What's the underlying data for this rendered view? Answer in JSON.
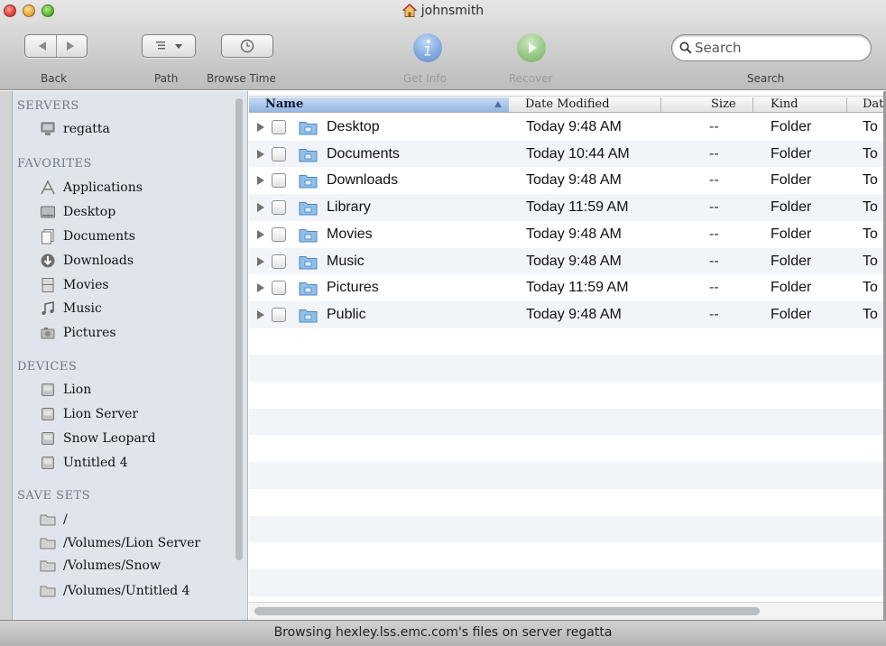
{
  "window": {
    "title": "johnsmith",
    "title_icon": "home-icon"
  },
  "toolbar": {
    "back_label": "Back",
    "path_label": "Path",
    "browse_time_label": "Browse Time",
    "get_info_label": "Get Info",
    "recover_label": "Recover",
    "search_label": "Search",
    "search_placeholder": "Search"
  },
  "sidebar": {
    "sections": [
      {
        "header": "SERVERS",
        "items": [
          {
            "label": "regatta",
            "icon": "server-icon"
          }
        ]
      },
      {
        "header": "FAVORITES",
        "items": [
          {
            "label": "Applications",
            "icon": "applications-icon"
          },
          {
            "label": "Desktop",
            "icon": "desktop-icon"
          },
          {
            "label": "Documents",
            "icon": "documents-icon"
          },
          {
            "label": "Downloads",
            "icon": "downloads-icon"
          },
          {
            "label": "Movies",
            "icon": "movies-icon"
          },
          {
            "label": "Music",
            "icon": "music-icon"
          },
          {
            "label": "Pictures",
            "icon": "pictures-icon"
          }
        ]
      },
      {
        "header": "DEVICES",
        "items": [
          {
            "label": "Lion",
            "icon": "disk-icon"
          },
          {
            "label": "Lion Server",
            "icon": "disk-icon"
          },
          {
            "label": "Snow Leopard",
            "icon": "disk-icon"
          },
          {
            "label": "Untitled 4",
            "icon": "disk-icon"
          }
        ]
      },
      {
        "header": "SAVE SETS",
        "items": [
          {
            "label": "/",
            "icon": "folder-icon"
          },
          {
            "label": "/Volumes/Lion Server",
            "icon": "folder-icon"
          },
          {
            "label": "/Volumes/Snow",
            "icon": "folder-icon"
          },
          {
            "label": "/Volumes/Untitled 4",
            "icon": "folder-icon"
          }
        ]
      }
    ]
  },
  "filelist": {
    "columns": [
      "Name",
      "Date Modified",
      "Size",
      "Kind",
      "Dat"
    ],
    "rows": [
      {
        "name": "Desktop",
        "date": "Today 9:48 AM",
        "size": "--",
        "kind": "Folder",
        "extra": "To"
      },
      {
        "name": "Documents",
        "date": "Today 10:44 AM",
        "size": "--",
        "kind": "Folder",
        "extra": "To"
      },
      {
        "name": "Downloads",
        "date": "Today 9:48 AM",
        "size": "--",
        "kind": "Folder",
        "extra": "To"
      },
      {
        "name": "Library",
        "date": "Today 11:59 AM",
        "size": "--",
        "kind": "Folder",
        "extra": "To"
      },
      {
        "name": "Movies",
        "date": "Today 9:48 AM",
        "size": "--",
        "kind": "Folder",
        "extra": "To"
      },
      {
        "name": "Music",
        "date": "Today 9:48 AM",
        "size": "--",
        "kind": "Folder",
        "extra": "To"
      },
      {
        "name": "Pictures",
        "date": "Today 11:59 AM",
        "size": "--",
        "kind": "Folder",
        "extra": "To"
      },
      {
        "name": "Public",
        "date": "Today 9:48 AM",
        "size": "--",
        "kind": "Folder",
        "extra": "To"
      }
    ]
  },
  "statusbar": {
    "text": "Browsing hexley.lss.emc.com's files on server regatta"
  },
  "colors": {
    "sidebar_bg": "#e0e5ec",
    "sidebar_header": "#6e7986",
    "selected_column": "#a9c4ea",
    "row_alt": "#f1f5fa",
    "folder_blue": "#6fa7d8"
  }
}
